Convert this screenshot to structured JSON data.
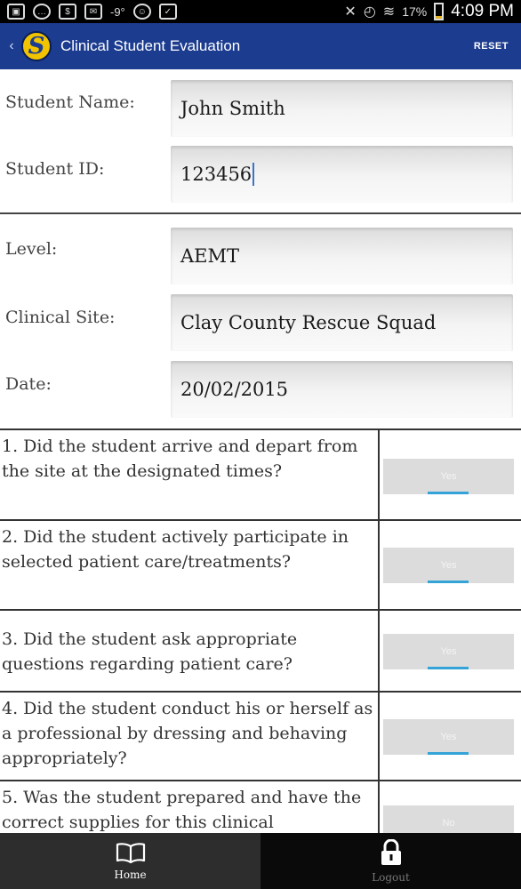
{
  "statusbar": {
    "temperature": "-9°",
    "battery_percent": "17%",
    "battery_level": 0.17,
    "time": "4:09 PM",
    "icons": [
      "image-icon",
      "chat-icon",
      "dollar-icon",
      "mail-icon",
      "android-icon",
      "clipboard-icon",
      "mute-icon",
      "alarm-icon",
      "wifi-icon",
      "battery-icon"
    ]
  },
  "appbar": {
    "back_glyph": "‹",
    "logo_letter": "S",
    "title": "Clinical Student Evaluation",
    "reset_label": "RESET"
  },
  "form": {
    "student_name": {
      "label": "Student Name:",
      "value": "John Smith"
    },
    "student_id": {
      "label": "Student ID:",
      "value": "123456"
    },
    "level": {
      "label": "Level:",
      "value": "AEMT"
    },
    "clinical_site": {
      "label": "Clinical  Site:",
      "value": "Clay County Rescue Squad"
    },
    "date": {
      "label": "Date:",
      "value": "20/02/2015"
    }
  },
  "questions": [
    {
      "text": "1. Did the student arrive and depart from the site at the designated times?",
      "answer": "Yes"
    },
    {
      "text": "2. Did the student actively participate in selected patient care/treatments?",
      "answer": "Yes"
    },
    {
      "text": "3. Did the student ask appropriate questions regarding patient care?",
      "answer": "Yes"
    },
    {
      "text": "4. Did the student conduct his or herself as a professional by dressing and behaving appropriately?",
      "answer": "Yes"
    },
    {
      "text": "5. Was the student prepared and have the correct supplies for this clinical",
      "answer": "No"
    }
  ],
  "bottomnav": {
    "home_label": "Home",
    "logout_label": "Logout"
  },
  "colors": {
    "appbar": "#1c3c8f",
    "toggle_indicator": "#34a3d8"
  }
}
